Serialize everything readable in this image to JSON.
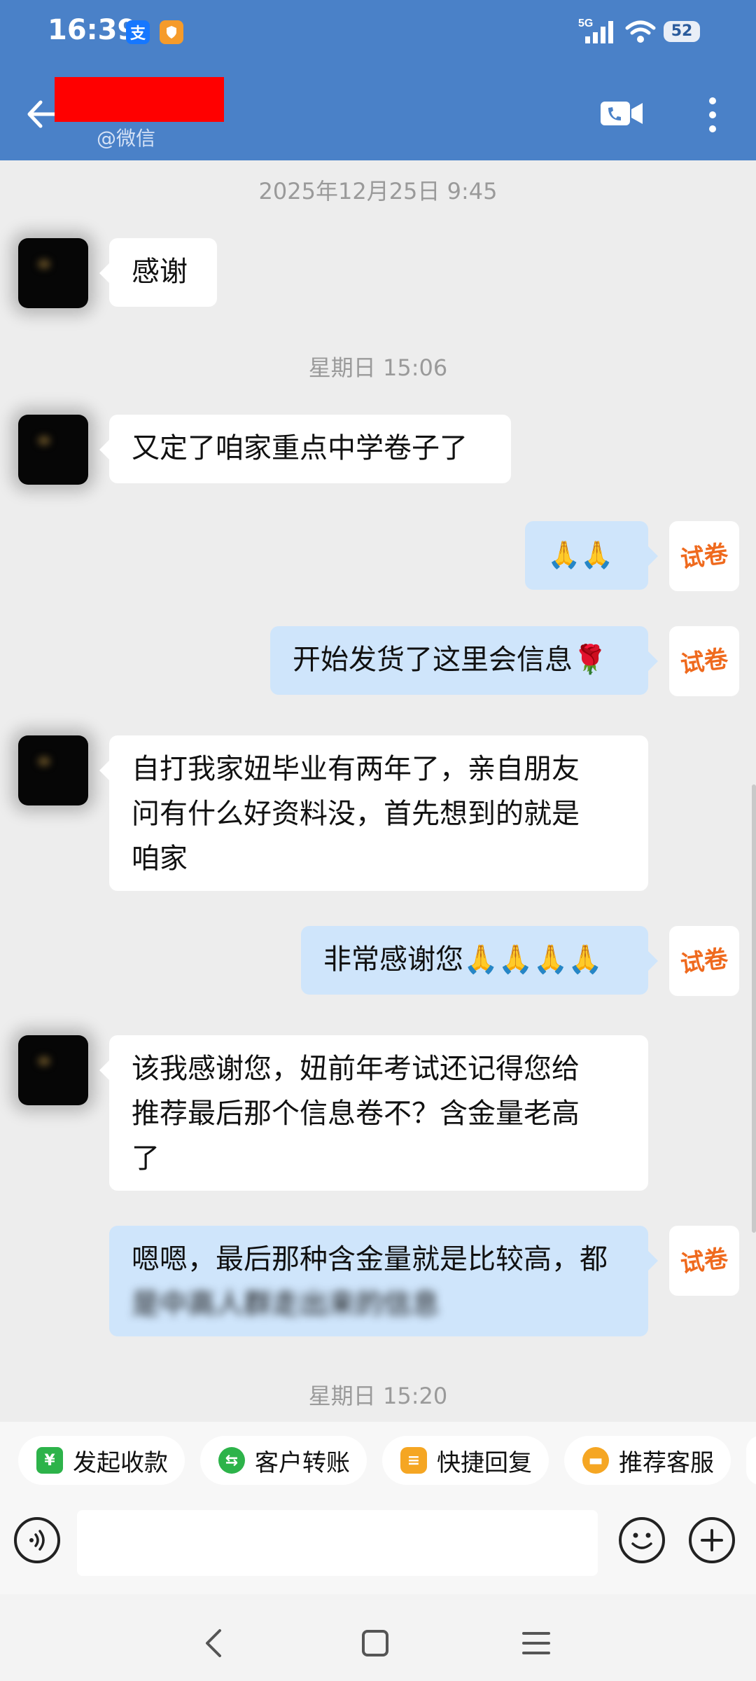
{
  "status_bar": {
    "time": "16:39",
    "alipay_badge": "支",
    "network": "5G",
    "battery": "52"
  },
  "header": {
    "subtitle": "@微信",
    "icons": {
      "back": "arrow-left-icon",
      "call": "video-call-icon",
      "more": "more-vertical-icon"
    },
    "color": "#4a81c8"
  },
  "messages": [
    {
      "type": "divider",
      "text": "2025年12月25日  9:45"
    },
    {
      "type": "in",
      "text": "感谢"
    },
    {
      "type": "divider",
      "text": "星期日  15:06"
    },
    {
      "type": "in",
      "text": "又定了咱家重点中学卷子了"
    },
    {
      "type": "out",
      "text": "🙏🙏"
    },
    {
      "type": "out",
      "text": "开始发货了这里会信息🌹"
    },
    {
      "type": "in",
      "lines": [
        "自打我家妞毕业有两年了，亲自朋友",
        "问有什么好资料没，首先想到的就是",
        "咱家"
      ]
    },
    {
      "type": "out",
      "text": "非常感谢您🙏🙏🙏🙏"
    },
    {
      "type": "in",
      "lines": [
        "该我感谢您，妞前年考试还记得您给",
        "推荐最后那个信息卷不？含金量老高",
        "了"
      ]
    },
    {
      "type": "out",
      "lines": [
        "嗯嗯，最后那种含金量就是比较高，都",
        "是中高人群走出来的信息"
      ]
    },
    {
      "type": "divider",
      "text": "星期日  15:20"
    }
  ],
  "self_avatar_text": "试卷",
  "quick_actions": [
    {
      "label": "发起收款",
      "icon": "yuan-icon",
      "color": "#2db34a"
    },
    {
      "label": "客户转账",
      "icon": "transfer-icon",
      "color": "#2db34a"
    },
    {
      "label": "快捷回复",
      "icon": "quick-reply-icon",
      "color": "#f5a623"
    },
    {
      "label": "推荐客服",
      "icon": "recommend-agent-icon",
      "color": "#f5a623"
    }
  ],
  "input": {
    "placeholder": ""
  },
  "nav": {
    "back": "nav-back-icon",
    "home": "nav-home-icon",
    "menu": "nav-menu-icon"
  }
}
